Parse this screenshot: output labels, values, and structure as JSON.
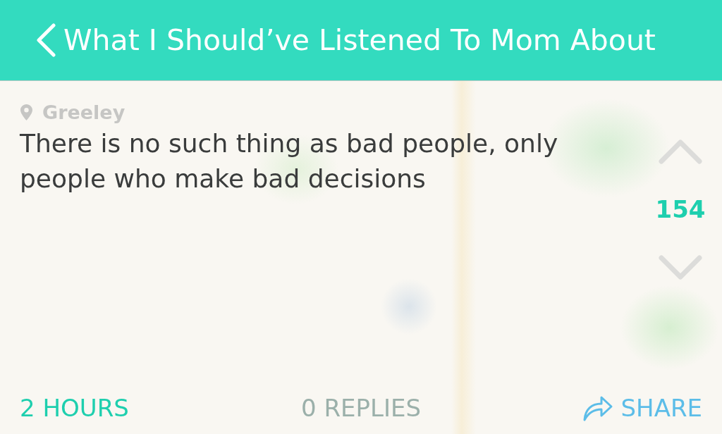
{
  "header": {
    "title": "What I Should’ve Listened To Mom About"
  },
  "post": {
    "location": "Greeley",
    "text": "There is no such thing as bad people, only people who make bad decisions",
    "votes": "154"
  },
  "footer": {
    "time": "2 HOURS",
    "replies": "0 REPLIES",
    "share": "SHARE"
  }
}
